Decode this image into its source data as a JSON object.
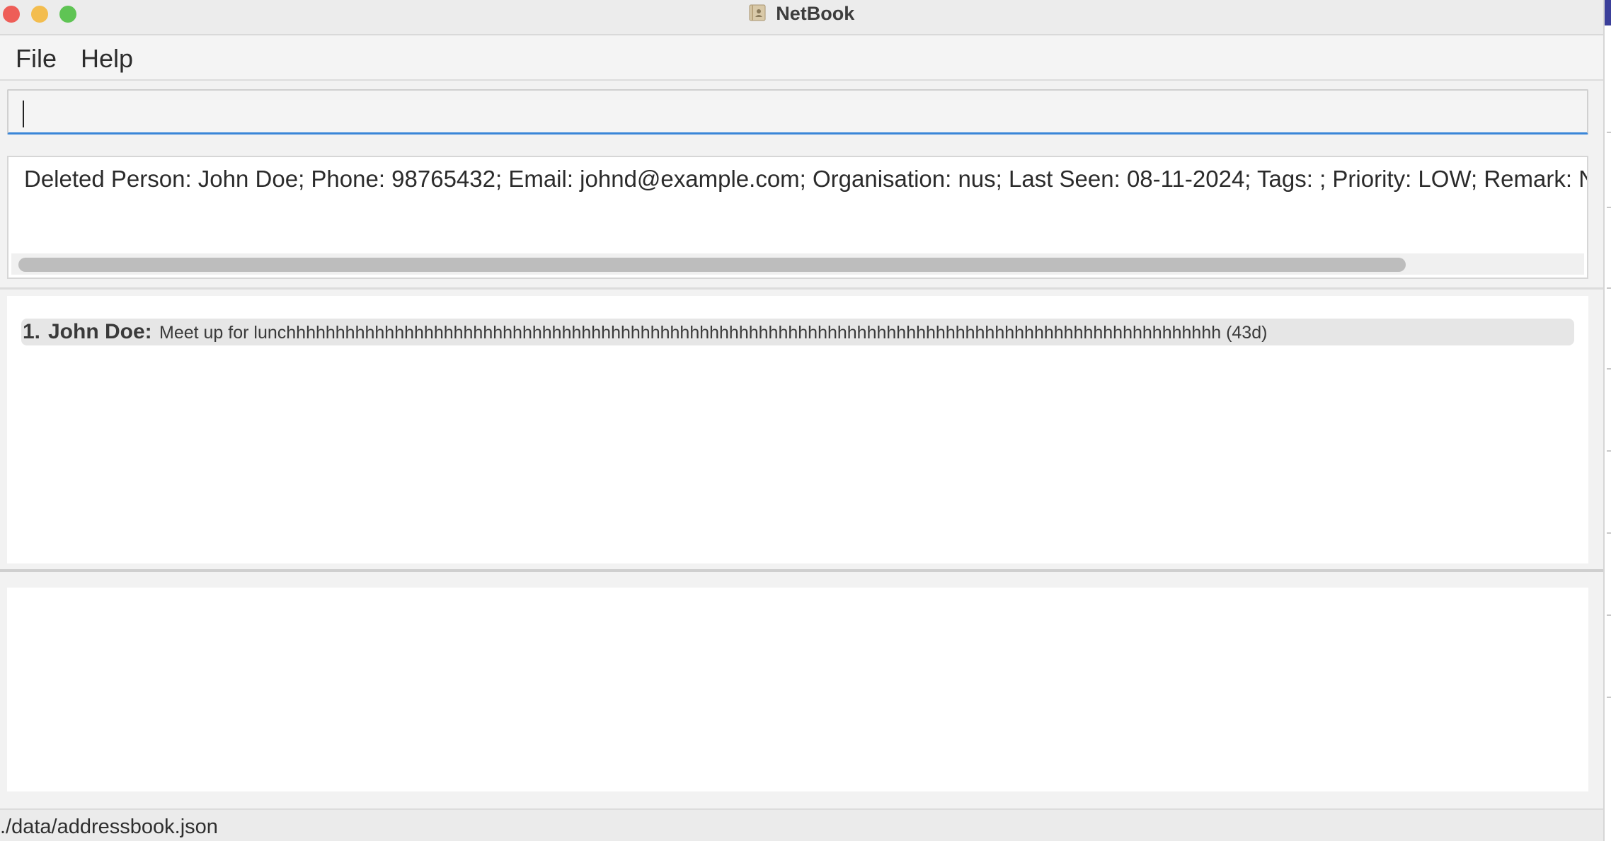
{
  "window": {
    "title": "NetBook"
  },
  "menu": {
    "items": [
      {
        "label": "File"
      },
      {
        "label": "Help"
      }
    ]
  },
  "command_box": {
    "value": "",
    "placeholder": ""
  },
  "result_display": {
    "text": "Deleted Person: John Doe; Phone: 98765432; Email: johnd@example.com; Organisation: nus; Last Seen: 08-11-2024; Tags: ; Priority: LOW; Remark: No r"
  },
  "list": {
    "items": [
      {
        "index": "1.",
        "name": "John Doe:",
        "text": "Meet up for lunchhhhhhhhhhhhhhhhhhhhhhhhhhhhhhhhhhhhhhhhhhhhhhhhhhhhhhhhhhhhhhhhhhhhhhhhhhhhhhhhhhhhhhhhhhhhhhh (43d)"
      }
    ]
  },
  "status_bar": {
    "path": "./data/addressbook.json"
  },
  "colors": {
    "close": "#ee5e58",
    "minimize": "#f3bd4f",
    "maximize": "#5fc454",
    "focus_accent": "#3a86d8"
  },
  "icons": {
    "app": "address-book-icon"
  }
}
